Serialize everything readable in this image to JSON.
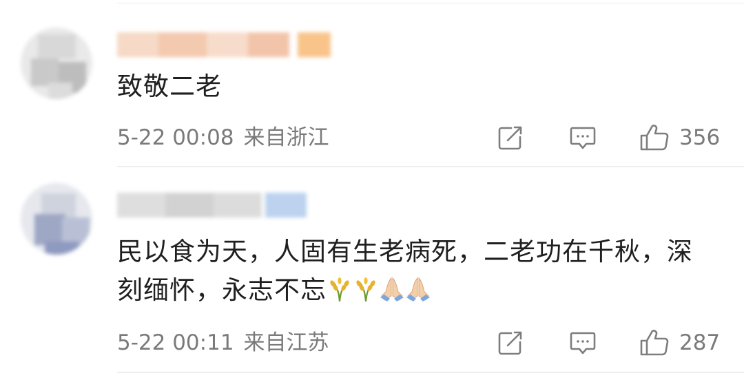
{
  "comments": [
    {
      "text": "致敬二老",
      "date": "5-22 00:08",
      "location": "来自浙江",
      "likes": "356"
    },
    {
      "text": "民以食为天，人固有生老病死，二老功在千秋，深刻缅怀，永志不忘",
      "emoji_icons": [
        "rice-icon",
        "rice-icon",
        "praying-hands-icon",
        "praying-hands-icon"
      ],
      "date": "5-22 00:11",
      "location": "来自江苏",
      "likes": "287"
    }
  ]
}
